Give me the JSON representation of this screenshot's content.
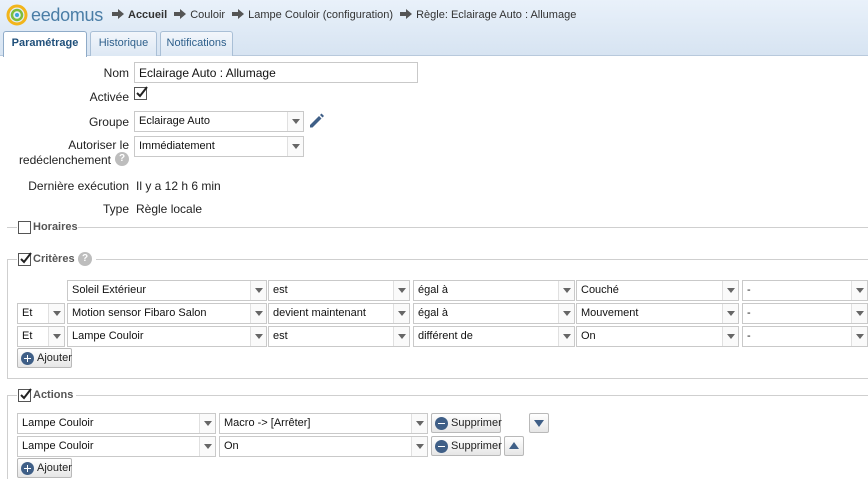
{
  "app": {
    "logo_text": "eedomus"
  },
  "breadcrumb": [
    "Accueil",
    "Couloir",
    "Lampe Couloir (configuration)",
    "Règle: Eclairage Auto : Allumage"
  ],
  "tabs": [
    {
      "label": "Paramétrage",
      "active": true
    },
    {
      "label": "Historique",
      "active": false
    },
    {
      "label": "Notifications",
      "active": false
    }
  ],
  "form": {
    "name_label": "Nom",
    "name_value": "Eclairage Auto : Allumage",
    "active_label": "Activée",
    "active_checked": true,
    "group_label": "Groupe",
    "group_value": "Eclairage Auto",
    "retrigger_label_1": "Autoriser le",
    "retrigger_label_2": "redéclenchement",
    "retrigger_value": "Immédiatement",
    "help_glyph": "?",
    "last_exec_label": "Dernière exécution",
    "last_exec_value": "Il y a 12 h 6 min",
    "type_label": "Type",
    "type_value": "Règle locale"
  },
  "sections": {
    "horaires": {
      "legend": "Horaires",
      "checked": false
    },
    "criteres": {
      "legend": "Critères",
      "checked": true
    },
    "actions": {
      "legend": "Actions",
      "checked": true
    }
  },
  "criteria": [
    {
      "logic": "",
      "device": "Soleil Extérieur",
      "verb": "est",
      "op": "égal à",
      "value": "Couché",
      "extra": "-"
    },
    {
      "logic": "Et",
      "device": "Motion sensor Fibaro Salon",
      "verb": "devient maintenant",
      "op": "égal à",
      "value": "Mouvement",
      "extra": "-"
    },
    {
      "logic": "Et",
      "device": "Lampe Couloir",
      "verb": "est",
      "op": "différent de",
      "value": "On",
      "extra": "-"
    }
  ],
  "actions": [
    {
      "device": "Lampe Couloir",
      "command": "Macro -> [Arrêter]",
      "delete_label": "Supprimer"
    },
    {
      "device": "Lampe Couloir",
      "command": "On",
      "delete_label": "Supprimer"
    }
  ],
  "buttons": {
    "add_label": "Ajouter"
  },
  "colors": {
    "accent": "#3f5f87",
    "header_bg": "#dde8f4",
    "tab_text": "#2d5f8b"
  }
}
